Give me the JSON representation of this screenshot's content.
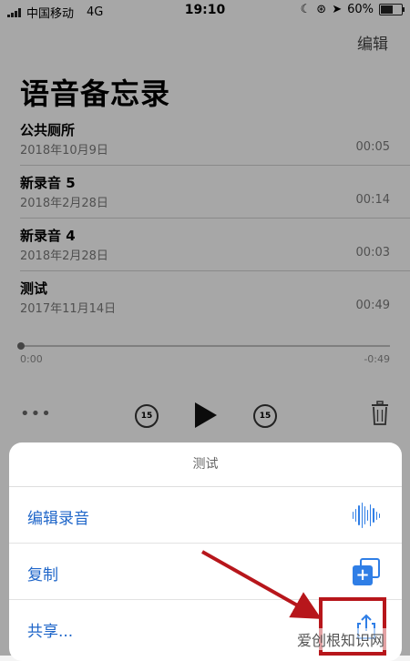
{
  "status_bar": {
    "carrier": "中国移动",
    "network": "4G",
    "time": "19:10",
    "battery": "60%",
    "battery_level": 0.6
  },
  "nav": {
    "edit_label": "编辑",
    "title": "语音备忘录"
  },
  "recordings": [
    {
      "name": "公共厕所",
      "date": "2018年10月9日",
      "duration": "00:05"
    },
    {
      "name": "新录音 5",
      "date": "2018年2月28日",
      "duration": "00:14"
    },
    {
      "name": "新录音 4",
      "date": "2018年2月28日",
      "duration": "00:03"
    },
    {
      "name": "测试",
      "date": "2017年11月14日",
      "duration": "00:49"
    }
  ],
  "player": {
    "time_start": "0:00",
    "time_remaining": "-0:49",
    "skip_back": "15",
    "skip_forward": "15",
    "more": "•••"
  },
  "action_sheet": {
    "title": "测试",
    "actions": [
      {
        "label": "编辑录音",
        "icon": "waveform-icon"
      },
      {
        "label": "复制",
        "icon": "duplicate-icon"
      },
      {
        "label": "共享...",
        "icon": "share-icon"
      }
    ]
  },
  "watermark": "爱创根知识网",
  "colors": {
    "accent": "#1f66c9",
    "annotation": "#b7161b"
  }
}
